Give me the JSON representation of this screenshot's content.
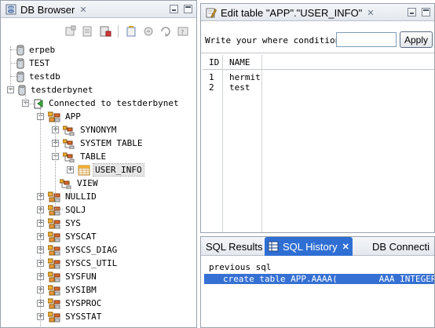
{
  "db_browser": {
    "title": "DB Browser",
    "tree": {
      "connections": [
        "erpeb",
        "TEST",
        "testdb",
        "testderbynet"
      ],
      "connected_label": "Connected to testderbynet",
      "schema_app": "APP",
      "app_children": [
        "SYNONYM",
        "SYSTEM TABLE",
        "TABLE",
        "VIEW"
      ],
      "table_child": "USER_INFO",
      "schemas": [
        "NULLID",
        "SQLJ",
        "SYS",
        "SYSCAT",
        "SYSCS_DIAG",
        "SYSCS_UTIL",
        "SYSFUN",
        "SYSIBM",
        "SYSPROC",
        "SYSSTAT"
      ]
    }
  },
  "edit_table": {
    "title": "Edit table \"APP\".\"USER_INFO\"",
    "where_label": "Write your where condition:",
    "where_value": "",
    "apply_label": "Apply",
    "columns": [
      "ID",
      "NAME"
    ],
    "rows": [
      [
        "1",
        "hermit"
      ],
      [
        "2",
        "test"
      ]
    ]
  },
  "sql_panel": {
    "tabs": [
      "SQL Results",
      "SQL History",
      "DB Connecti"
    ],
    "active_tab": "SQL History",
    "history_title": "previous sql",
    "history_rows": [
      "create table APP.AAAA(        AAA INTEGER not"
    ]
  },
  "colors": {
    "active_tab": "#2f6fd4",
    "selection": "#3670d3",
    "pane_border": "#9ca3ad"
  }
}
